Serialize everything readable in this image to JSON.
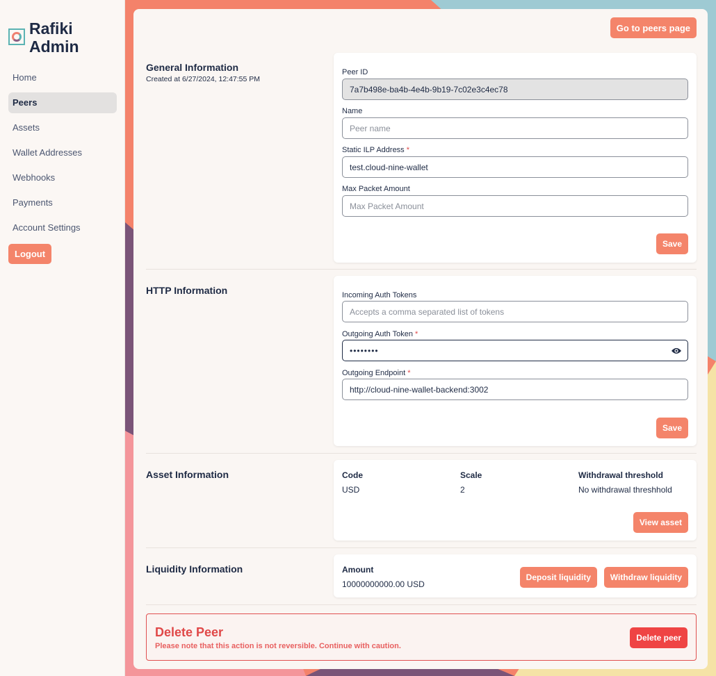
{
  "sidebar": {
    "brand_line1": "Rafiki",
    "brand_line2": "Admin",
    "items": [
      {
        "label": "Home"
      },
      {
        "label": "Peers"
      },
      {
        "label": "Assets"
      },
      {
        "label": "Wallet Addresses"
      },
      {
        "label": "Webhooks"
      },
      {
        "label": "Payments"
      },
      {
        "label": "Account Settings"
      }
    ],
    "active_item": "Peers",
    "logout_label": "Logout"
  },
  "header": {
    "go_to_peers_label": "Go to peers page"
  },
  "general": {
    "title": "General Information",
    "created": "Created at 6/27/2024, 12:47:55 PM",
    "peer_id_label": "Peer ID",
    "peer_id_value": "7a7b498e-ba4b-4e4b-9b19-7c02e3c4ec78",
    "name_label": "Name",
    "name_placeholder": "Peer name",
    "ilp_label": "Static ILP Address",
    "ilp_value": "test.cloud-nine-wallet",
    "max_packet_label": "Max Packet Amount",
    "max_packet_placeholder": "Max Packet Amount",
    "save_label": "Save"
  },
  "http": {
    "title": "HTTP Information",
    "incoming_label": "Incoming Auth Tokens",
    "incoming_placeholder": "Accepts a comma separated list of tokens",
    "outgoing_token_label": "Outgoing Auth Token",
    "outgoing_token_value": "••••••••",
    "outgoing_endpoint_label": "Outgoing Endpoint",
    "outgoing_endpoint_value": "http://cloud-nine-wallet-backend:3002",
    "save_label": "Save"
  },
  "asset": {
    "title": "Asset Information",
    "columns": [
      "Code",
      "Scale",
      "Withdrawal threshold"
    ],
    "values": [
      "USD",
      "2",
      "No withdrawal threshhold"
    ],
    "view_label": "View asset"
  },
  "liquidity": {
    "title": "Liquidity Information",
    "amount_label": "Amount",
    "amount_value": "10000000000.00 USD",
    "deposit_label": "Deposit liquidity",
    "withdraw_label": "Withdraw liquidity"
  },
  "delete": {
    "title": "Delete Peer",
    "note": "Please note that this action is not reversible. Continue with caution.",
    "button_label": "Delete peer"
  },
  "required_marker": "*",
  "colors": {
    "accent": "#f4846a",
    "danger": "#ef4444",
    "teal": "#9ecad3",
    "purple": "#7a5478",
    "pink": "#f4959a",
    "sand": "#f5e3a6"
  }
}
